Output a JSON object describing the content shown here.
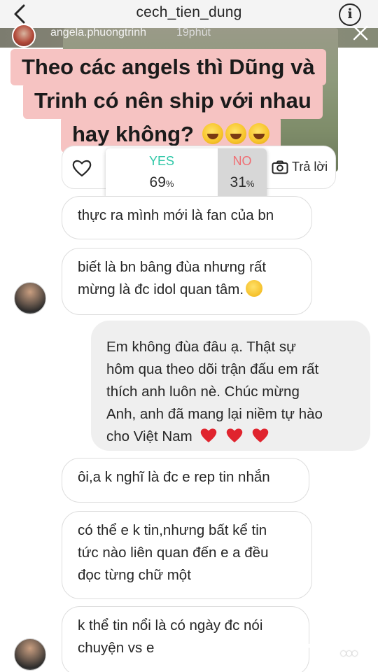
{
  "header": {
    "title": "cech_tien_dung",
    "info_icon": "info-icon",
    "back_icon": "chevron-left-icon"
  },
  "story": {
    "username": "angela.phuongtrinh",
    "time": "19phút",
    "question_lines": [
      "Theo các angels thì Dũng và",
      "Trinh có nên ship với nhau",
      "hay không?"
    ],
    "emoji": "rolling-on-floor-laughing-emoji"
  },
  "poll": {
    "yes_label": "YES",
    "yes_percent": "69",
    "no_label": "NO",
    "no_percent": "31",
    "percent_sign": "%",
    "yes_value": 69,
    "no_value": 31,
    "reply_label": "Trả lời",
    "yes_color": "#2fc7a7",
    "no_color": "#ef6f74"
  },
  "messages": [
    {
      "from": "other",
      "lines": [
        "thực ra mình mới là fan của bn"
      ]
    },
    {
      "from": "other",
      "lines": [
        "biết là bn bâng đùa nhưng rất",
        "mừng là đc idol quan tâm."
      ],
      "emoji": "smiling-face-emoji"
    },
    {
      "from": "me",
      "lines": [
        "Em không đùa đâu ạ. Thật sự",
        "hôm qua theo dõi trận đấu em rất",
        "thích anh luôn nè. Chúc mừng",
        "Anh, anh đã mang lại niềm tự hào",
        "cho Việt Nam"
      ],
      "emoji": "red-heart-emoji"
    },
    {
      "from": "other",
      "lines": [
        "ôi,a k nghĩ là đc e rep tin nhắn"
      ]
    },
    {
      "from": "other",
      "lines": [
        "có thể e k tin,nhưng bất kể tin",
        "tức nào liên quan đến e a đều",
        "đọc từng chữ một"
      ]
    },
    {
      "from": "other",
      "lines": [
        "k thể tin nổi là có ngày đc nói",
        "chuyện vs e"
      ]
    }
  ],
  "footer": {
    "send_icon": "send-icon",
    "more_label": "•••"
  }
}
